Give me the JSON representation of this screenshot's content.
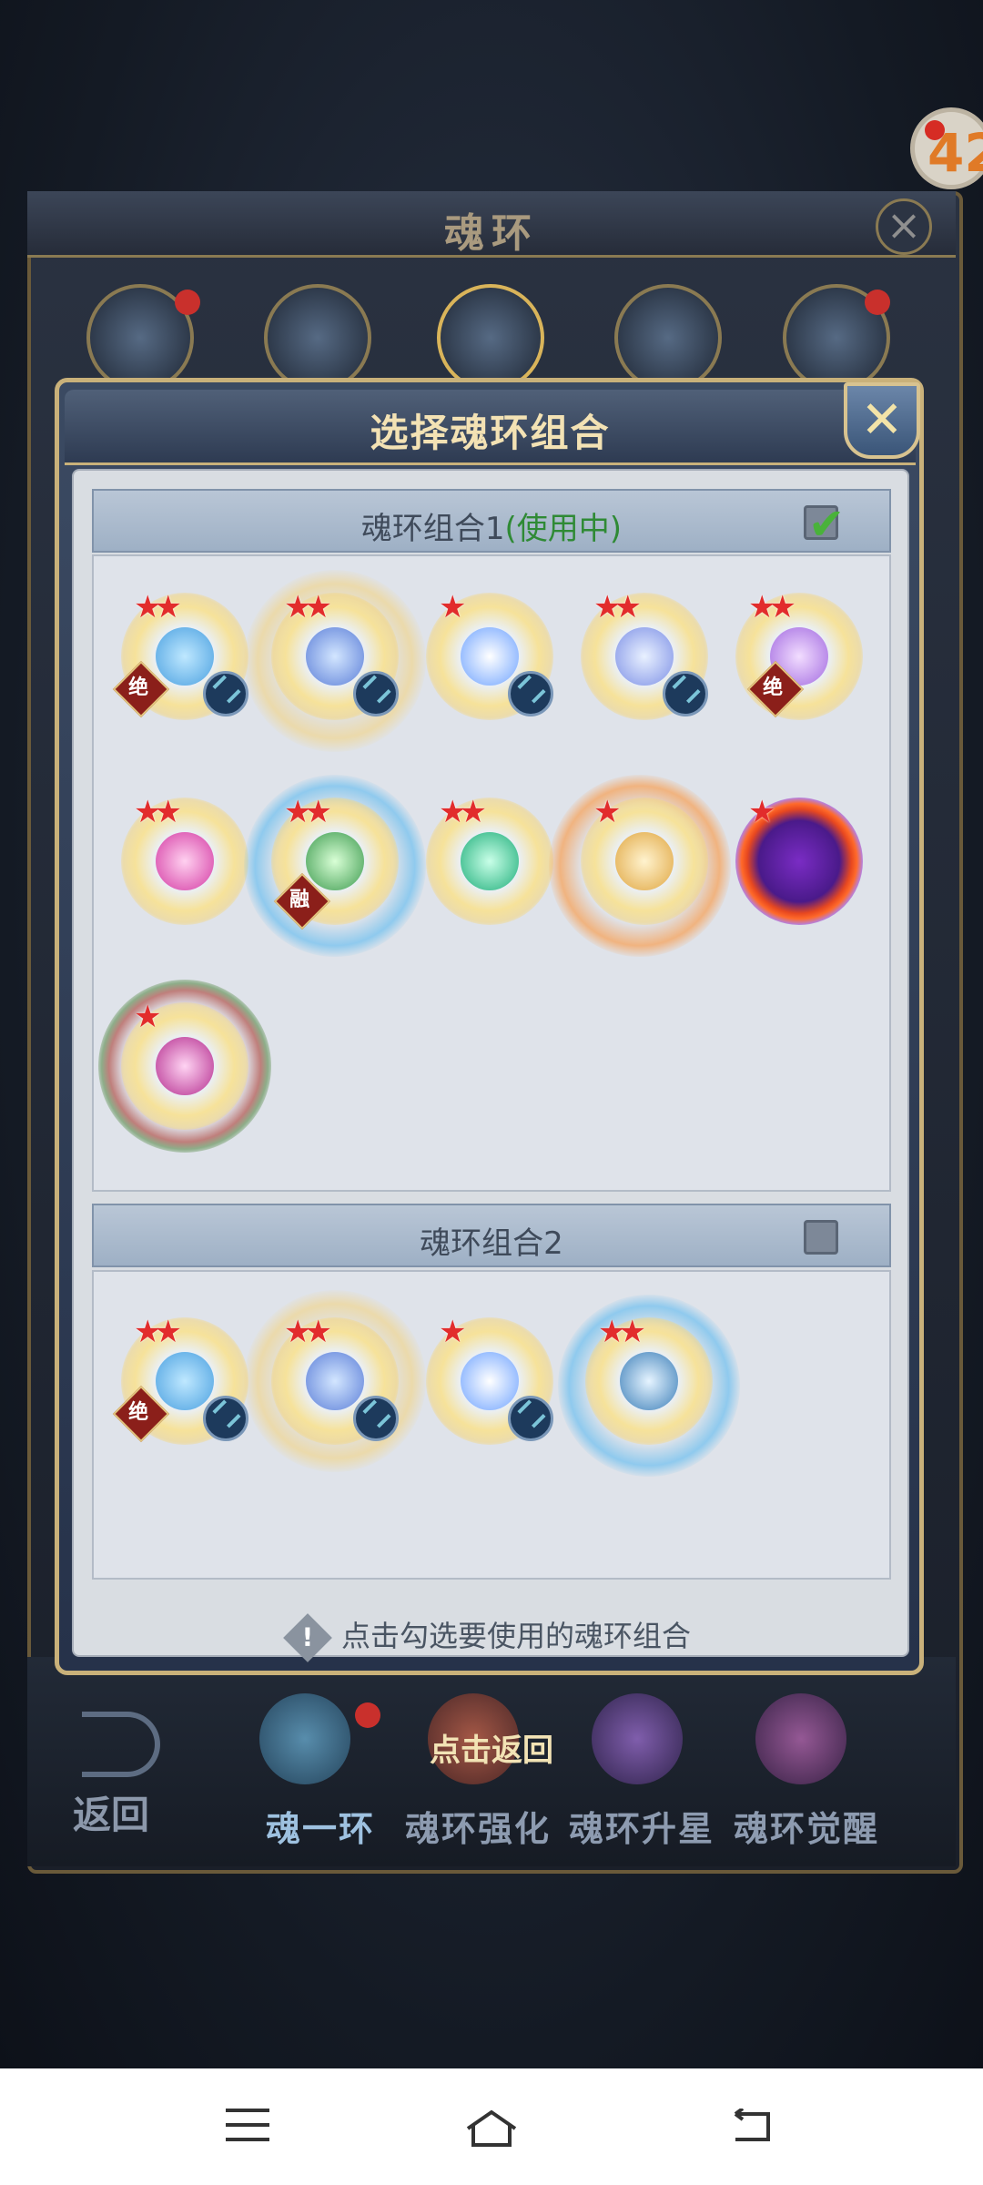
{
  "background": {
    "title": "魂环",
    "timer_text": "42",
    "bottom_nav": {
      "back_label": "返回",
      "hint": "点击返回",
      "tabs": [
        "魂一环",
        "魂环强化",
        "魂环升星",
        "魂环觉醒"
      ]
    }
  },
  "modal": {
    "title": "选择魂环组合",
    "close_icon": "close-icon",
    "groups": [
      {
        "label": "魂环组合1",
        "status": "(使用中)",
        "checked": true,
        "rings": [
          {
            "stars": 2,
            "badge": "绝"
          },
          {
            "stars": 2,
            "badge": ""
          },
          {
            "stars": 1,
            "badge": ""
          },
          {
            "stars": 2,
            "badge": ""
          },
          {
            "stars": 2,
            "badge": "绝"
          },
          {
            "stars": 2,
            "badge": ""
          },
          {
            "stars": 2,
            "badge": "融"
          },
          {
            "stars": 2,
            "badge": ""
          },
          {
            "stars": 1,
            "badge": ""
          },
          {
            "stars": 1,
            "badge": ""
          },
          {
            "stars": 1,
            "badge": ""
          }
        ]
      },
      {
        "label": "魂环组合2",
        "status": "",
        "checked": false,
        "rings": [
          {
            "stars": 2,
            "badge": "绝"
          },
          {
            "stars": 2,
            "badge": ""
          },
          {
            "stars": 1,
            "badge": ""
          },
          {
            "stars": 2,
            "badge": ""
          }
        ]
      }
    ],
    "hint": "点击勾选要使用的魂环组合"
  },
  "colors": {
    "accent_gold": "#c9b17a",
    "in_use_green": "#2f8a35",
    "star_red": "#e22c2c"
  }
}
